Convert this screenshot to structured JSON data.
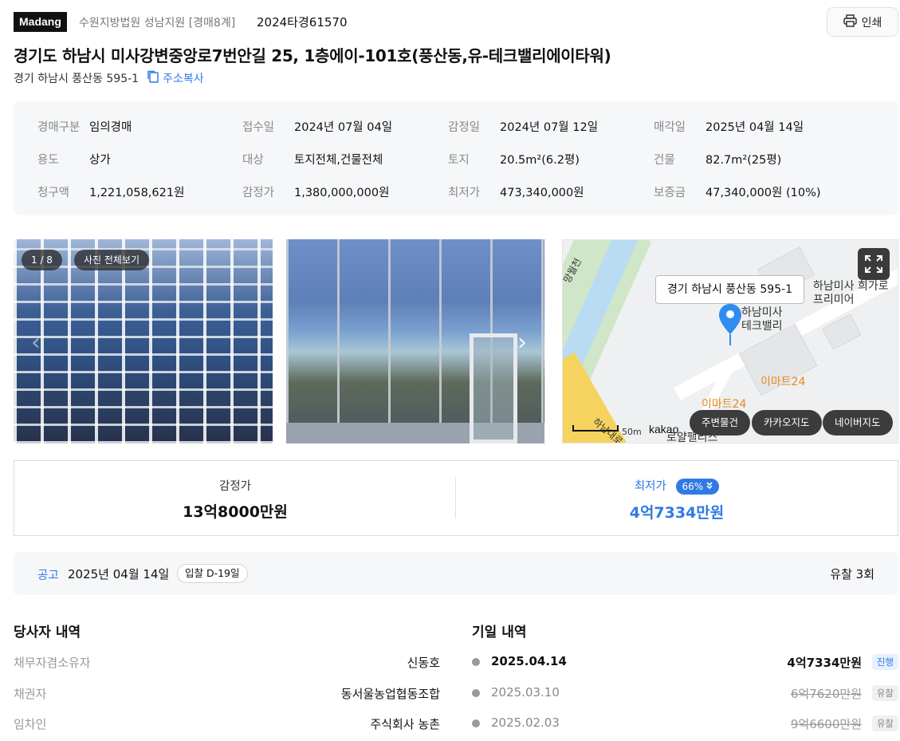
{
  "header": {
    "logo": "Madang",
    "court": "수원지방법원 성남지원 [경매8계]",
    "case_no": "2024타경61570",
    "print_label": "인쇄"
  },
  "title": "경기도 하남시 미사강변중앙로7번안길 25, 1층에이-101호(풍산동,유-테크밸리에이타워)",
  "lot_address": "경기 하남시 풍산동 595-1",
  "copy_label": "주소복사",
  "info": [
    {
      "k": "경매구분",
      "v": "임의경매"
    },
    {
      "k": "접수일",
      "v": "2024년 07월 04일"
    },
    {
      "k": "감정일",
      "v": "2024년 07월 12일"
    },
    {
      "k": "매각일",
      "v": "2025년 04월 14일"
    },
    {
      "k": "용도",
      "v": "상가"
    },
    {
      "k": "대상",
      "v": "토지전체,건물전체"
    },
    {
      "k": "토지",
      "v": "20.5m²(6.2평)"
    },
    {
      "k": "건물",
      "v": "82.7m²(25평)"
    },
    {
      "k": "청구액",
      "v": "1,221,058,621원"
    },
    {
      "k": "감정가",
      "v": "1,380,000,000원"
    },
    {
      "k": "최저가",
      "v": "473,340,000원"
    },
    {
      "k": "보증금",
      "v": "47,340,000원 (10%)"
    }
  ],
  "photos": {
    "counter": "1 / 8",
    "view_all": "사진 전체보기"
  },
  "map": {
    "callout": "경기 하남시 풍산동 595-1",
    "road_label": "망월천",
    "poi_1": "하남미사 희가로\n프리미어",
    "poi_target": "하남미사\n테크밸리",
    "poi_emart_1": "이마트24",
    "poi_emart_2": "이마트24",
    "poi_bottom": "로얄팰리스",
    "road_bottom": "하남대로",
    "scale": "50m",
    "provider": "kakao",
    "btn_nearby": "주변물건",
    "btn_kakao": "카카오지도",
    "btn_naver": "네이버지도"
  },
  "price": {
    "appraisal_label": "감정가",
    "appraisal_value": "13억8000만원",
    "min_label": "최저가",
    "min_pct": "66%",
    "min_value": "4억7334만원"
  },
  "notice": {
    "label": "공고",
    "date": "2025년 04월 14일",
    "dday": "입찰 D-19일",
    "fail_count": "유찰 3회"
  },
  "parties": {
    "title": "당사자 내역",
    "rows": [
      {
        "k": "채무자겸소유자",
        "v": "신동호"
      },
      {
        "k": "채권자",
        "v": "동서울농업협동조합"
      },
      {
        "k": "임차인",
        "v": "주식회사 농촌"
      }
    ]
  },
  "schedule": {
    "title": "기일 내역",
    "rows": [
      {
        "date": "2025.04.14",
        "price": "4억7334만원",
        "status": "진행"
      },
      {
        "date": "2025.03.10",
        "price": "6억7620만원",
        "status": "유찰"
      },
      {
        "date": "2025.02.03",
        "price": "9억6600만원",
        "status": "유찰"
      }
    ]
  },
  "colors": {
    "accent": "#2f7ae5",
    "logo_bg": "#111111",
    "info_bg": "#f6f7f9",
    "emart": "#e78a1f"
  }
}
